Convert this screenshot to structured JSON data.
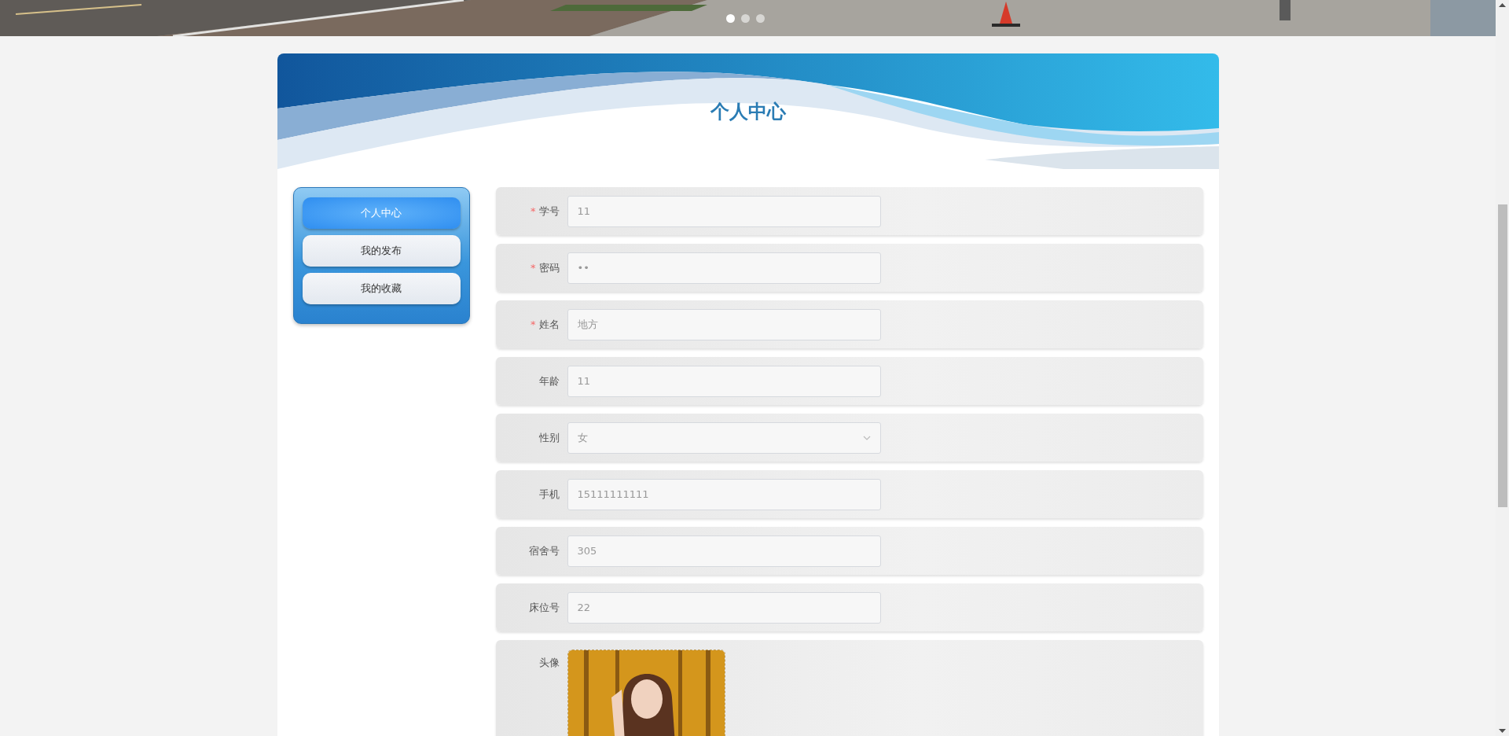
{
  "banner": {
    "kind": "picture",
    "dots": [
      {
        "selected": true
      },
      {
        "selected": false
      },
      {
        "selected": false
      }
    ]
  },
  "title": "个人中心",
  "sidebar": {
    "items": [
      {
        "label": "个人中心",
        "selected": true
      },
      {
        "label": "我的发布",
        "selected": false
      },
      {
        "label": "我的收藏",
        "selected": false
      }
    ]
  },
  "form": {
    "fields": [
      {
        "kind": "text",
        "label": "学号",
        "required_mark": "*",
        "value": "11"
      },
      {
        "kind": "password",
        "label": "密码",
        "required_mark": "*",
        "value": "••"
      },
      {
        "kind": "text",
        "label": "姓名",
        "required_mark": "*",
        "value": "地方"
      },
      {
        "kind": "text",
        "label": "年龄",
        "value": "11"
      },
      {
        "kind": "select",
        "label": "性别",
        "value": "女"
      },
      {
        "kind": "text",
        "label": "手机",
        "value": "15111111111"
      },
      {
        "kind": "text",
        "label": "宿舍号",
        "value": "305"
      },
      {
        "kind": "text",
        "label": "床位号",
        "value": "22"
      },
      {
        "label": "头像"
      }
    ]
  }
}
